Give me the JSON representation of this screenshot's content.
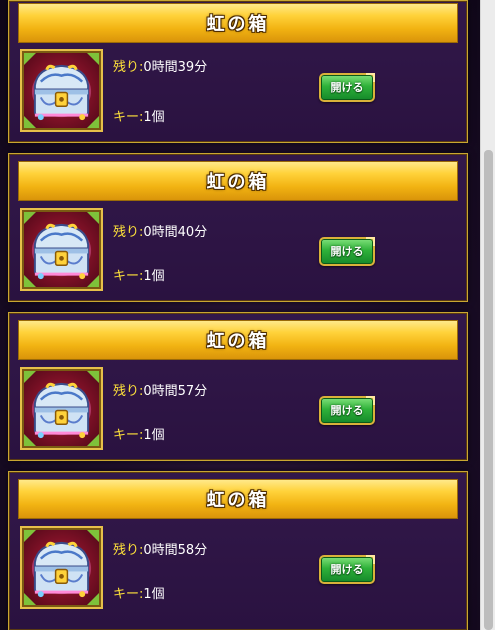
{
  "boxes": [
    {
      "title": "虹の箱",
      "remaining_label": "残り:",
      "remaining_value": "0時間39分",
      "key_label": "キー:",
      "key_value": "1個",
      "button": "開ける"
    },
    {
      "title": "虹の箱",
      "remaining_label": "残り:",
      "remaining_value": "0時間40分",
      "key_label": "キー:",
      "key_value": "1個",
      "button": "開ける"
    },
    {
      "title": "虹の箱",
      "remaining_label": "残り:",
      "remaining_value": "0時間57分",
      "key_label": "キー:",
      "key_value": "1個",
      "button": "開ける"
    },
    {
      "title": "虹の箱",
      "remaining_label": "残り:",
      "remaining_value": "0時間58分",
      "key_label": "キー:",
      "key_value": "1個",
      "button": "開ける"
    }
  ],
  "icons": {
    "chest": "rainbow-chest-icon"
  },
  "colors": {
    "header_gold": "#f2b312",
    "label_yellow": "#ffe23a",
    "button_green": "#2fb23a",
    "card_bg": "#2a1240",
    "frame_red": "#7a1025"
  }
}
